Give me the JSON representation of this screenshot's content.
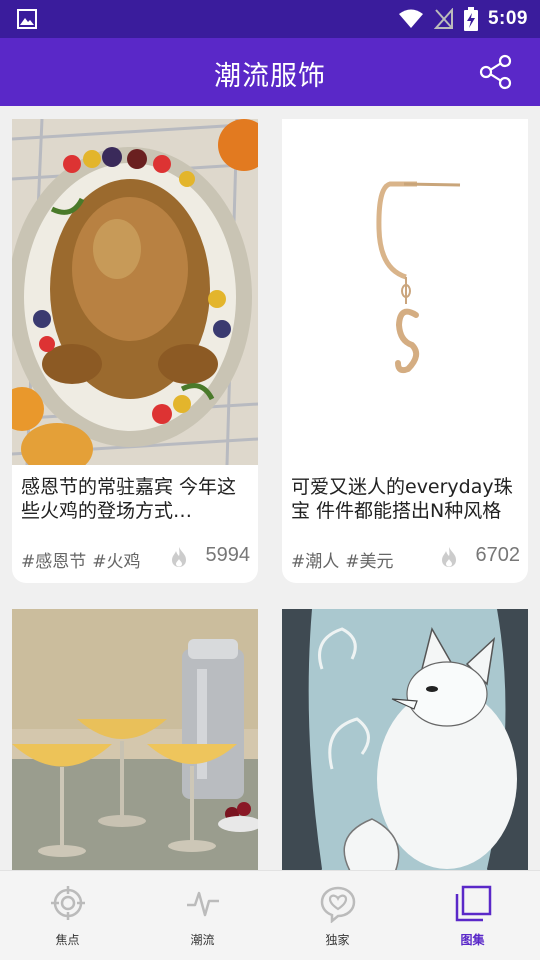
{
  "status": {
    "time": "5:09"
  },
  "header": {
    "title": "潮流服饰"
  },
  "cards": [
    {
      "caption": "感恩节的常驻嘉宾 今年这些火鸡的登场方式…",
      "tags": [
        "#感恩节",
        "#火鸡"
      ],
      "count": "5994"
    },
    {
      "caption": "可爱又迷人的everyday珠宝 件件都能搭出N种风格",
      "tags": [
        "#潮人",
        "#美元"
      ],
      "count": "6702"
    }
  ],
  "nav": [
    {
      "label": "焦点",
      "icon": "target-icon"
    },
    {
      "label": "潮流",
      "icon": "pulse-icon"
    },
    {
      "label": "独家",
      "icon": "heart-chat-icon"
    },
    {
      "label": "图集",
      "icon": "gallery-stack-icon"
    }
  ],
  "colors": {
    "statusbar": "#3a1c9c",
    "appbar": "#5a28c8",
    "accent": "#5a28c8"
  }
}
